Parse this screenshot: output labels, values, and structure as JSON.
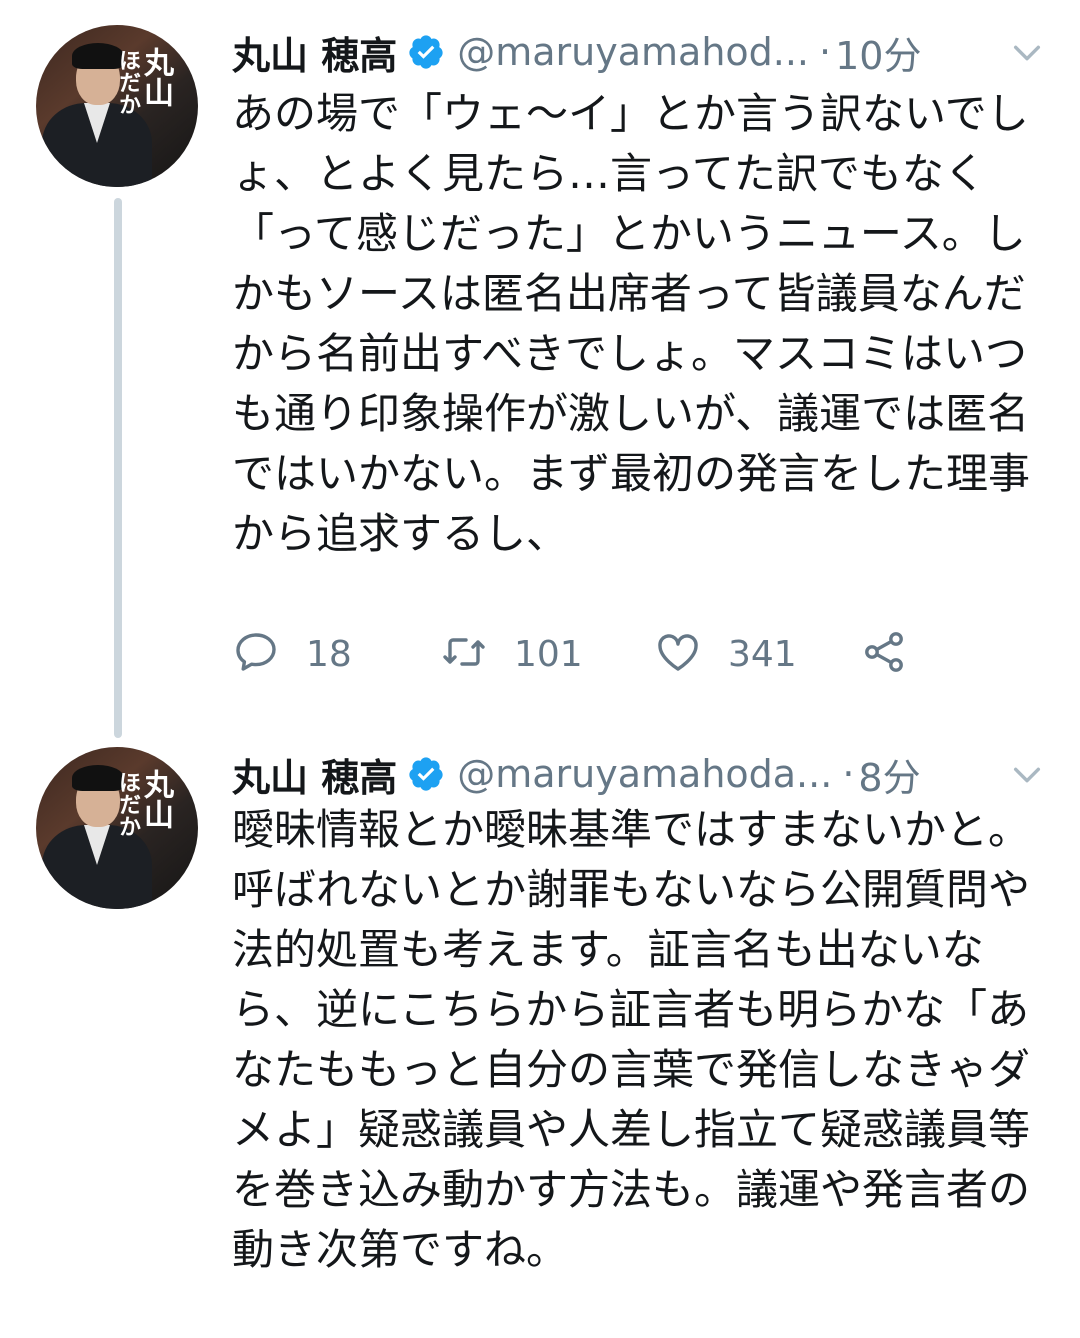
{
  "colors": {
    "text": "#14171a",
    "secondary": "#657786",
    "verified": "#1da1f2",
    "thread_line": "#ccd6dd"
  },
  "tweets": [
    {
      "author": {
        "name": "丸山 穂高",
        "handle": "@maruyamahod...",
        "avatar_text_large": "丸山",
        "avatar_text_small": "ほだか"
      },
      "separator": "·",
      "time": "10分",
      "text": "あの場で「ウェ〜イ」とか言う訳ないでしょ、とよく見たら…言ってた訳でもなく「って感じだった」とかいうニュース。しかもソースは匿名出席者って皆議員なんだから名前出すべきでしょ。マスコミはいつも通り印象操作が激しいが、議運では匿名ではいかない。まず最初の発言をした理事から追求するし、",
      "actions": {
        "reply_count": "18",
        "retweet_count": "101",
        "like_count": "341"
      },
      "icons": [
        "verified-icon",
        "chevron-down-icon",
        "reply-icon",
        "retweet-icon",
        "heart-icon",
        "share-icon"
      ]
    },
    {
      "author": {
        "name": "丸山 穂高",
        "handle": "@maruyamahoda...",
        "avatar_text_large": "丸山",
        "avatar_text_small": "ほだか"
      },
      "separator": "·",
      "time": "8分",
      "text": "曖昧情報とか曖昧基準ではすまないかと。呼ばれないとか謝罪もないなら公開質問や法的処置も考えます。証言名も出ないなら、逆にこちらから証言者も明らかな「あなたももっと自分の言葉で発信しなきゃダメよ」疑惑議員や人差し指立て疑惑議員等を巻き込み動かす方法も。議運や発言者の動き次第ですね。",
      "icons": [
        "verified-icon",
        "chevron-down-icon"
      ]
    }
  ]
}
